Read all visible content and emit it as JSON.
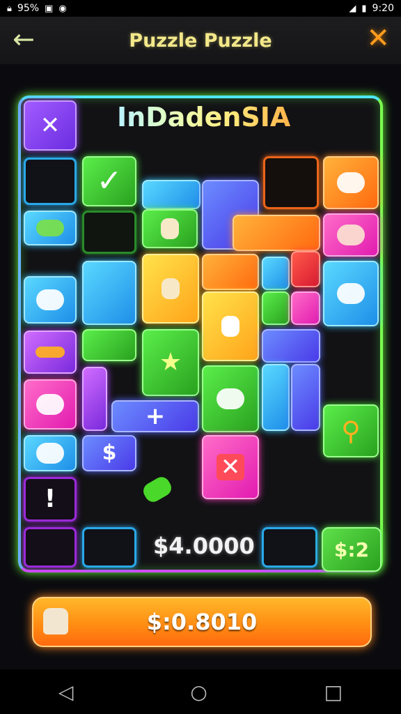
{
  "status": {
    "battery": "95%",
    "time": "9:20"
  },
  "header": {
    "title": "Puzzle Puzzle",
    "back_icon": "arrow-left-icon",
    "close_icon": "close-icon"
  },
  "board": {
    "level_name": "InDadenSIA",
    "score": "$4.0000",
    "badge": "$:2"
  },
  "tiles": {
    "plus": "+",
    "dollar": "$",
    "exclaim": "!",
    "x_mark": "✕",
    "check": "✓",
    "star": "★"
  },
  "footer": {
    "price": "$:0.8010",
    "chef_icon": "chef-hat-icon"
  },
  "nav": {
    "back": "◁",
    "home": "○",
    "recents": "□"
  }
}
